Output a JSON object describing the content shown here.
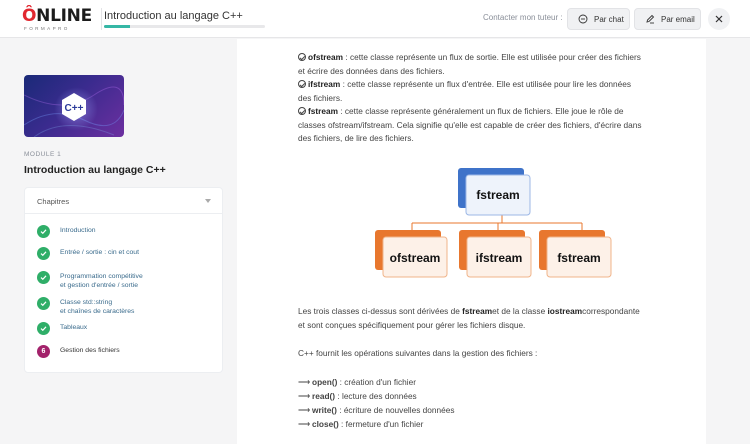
{
  "header": {
    "logo_main": "ONLINE",
    "logo_sub": "FORMAPRO",
    "course_title": "Introduction au langage C++",
    "progress_fraction": 0.16,
    "contact_label": "Contacter mon tuteur :",
    "chat_label": "Par chat",
    "email_label": "Par email"
  },
  "sidebar": {
    "thumb_text": "C++",
    "module_label": "MODULE 1",
    "module_title": "Introduction au langage C++",
    "chapters_label": "Chapitres",
    "chapters": [
      {
        "label": "Introduction",
        "status": "done"
      },
      {
        "label": "Entrée / sortie : cin et cout",
        "status": "done"
      },
      {
        "line1": "Programmation compétitive",
        "line2": "et gestion d'entrée / sortie",
        "status": "done"
      },
      {
        "line1": "Classe std::string",
        "line2": "et chaînes de caractères",
        "status": "done"
      },
      {
        "label": "Tableaux",
        "status": "done"
      },
      {
        "label": "Gestion des fichiers",
        "status": "current",
        "number": "6"
      }
    ]
  },
  "content": {
    "ofstream_term": "ofstream",
    "ofstream_desc_1": " : cette classe représente un flux de sortie. Elle est utilisée pour créer des fichiers",
    "ofstream_desc_2": "et écrire des données dans des fichiers.",
    "ifstream_term": "ifstream",
    "ifstream_desc_1": " : cette classe représente un flux d'entrée. Elle est utilisée pour lire les données",
    "ifstream_desc_2": "des fichiers.",
    "fstream_term": "fstream",
    "fstream_desc_1": " : cette classe représente généralement un flux de fichiers. Elle joue le rôle de",
    "fstream_desc_2": "classes ofstream/ifstream. Cela signifie qu'elle est capable de créer des fichiers, d'écrire dans",
    "fstream_desc_3": "des fichiers, de lire des fichiers.",
    "diagram": {
      "root": "fstream",
      "children": [
        "ofstream",
        "ifstream",
        "fstream"
      ],
      "blue": "#3f73c9",
      "orange": "#e8772e"
    },
    "derived_1a": "Les trois classes ci-dessus sont dérivées de ",
    "derived_1b": "fstream",
    "derived_1c": "et de la classe ",
    "derived_1d": "iostream",
    "derived_1e": "correspondante",
    "derived_2": "et sont conçues spécifiquement pour gérer les fichiers disque.",
    "ops_intro": "C++ fournit les opérations suivantes dans la gestion des fichiers :",
    "ops": [
      {
        "fn": "open()",
        "desc": " : création d'un fichier"
      },
      {
        "fn": "read()",
        "desc": " : lecture des données"
      },
      {
        "fn": "write()",
        "desc": " : écriture de nouvelles données"
      },
      {
        "fn": "close()",
        "desc": " : fermeture d'un fichier"
      }
    ]
  }
}
